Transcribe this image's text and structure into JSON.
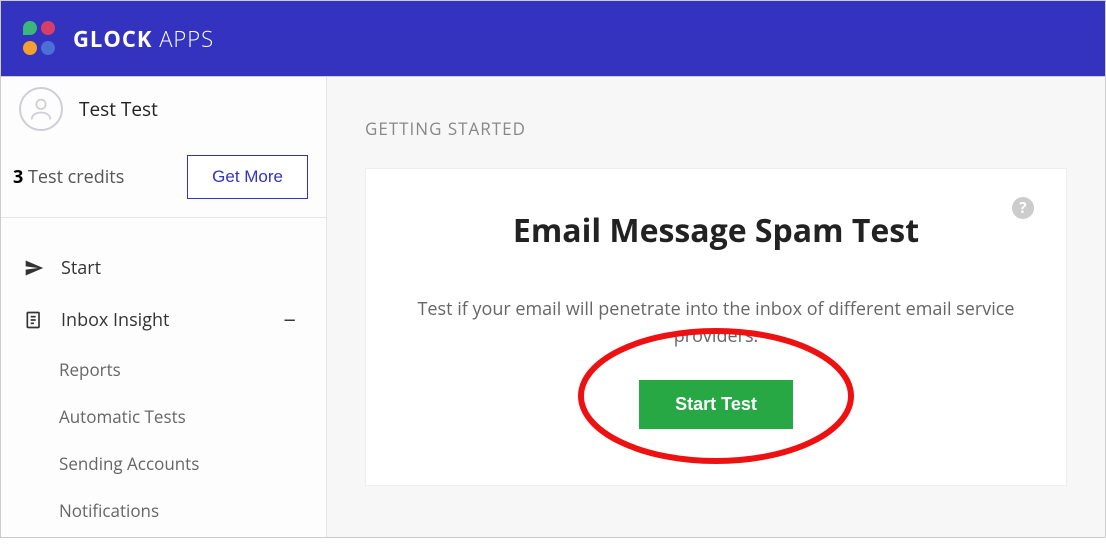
{
  "brand": {
    "name_bold": "GLOCK",
    "name_light": " APPS",
    "colors": [
      "#3ab879",
      "#d73f6a",
      "#f4a02e",
      "#4a6fd6"
    ]
  },
  "user": {
    "name": "Test Test",
    "credits_count": "3",
    "credits_label": " Test credits",
    "get_more_label": "Get More"
  },
  "nav": {
    "start": "Start",
    "inbox_insight": "Inbox Insight",
    "sub": {
      "reports": "Reports",
      "automatic_tests": "Automatic Tests",
      "sending_accounts": "Sending Accounts",
      "notifications": "Notifications"
    }
  },
  "main": {
    "section_title": "GETTING STARTED",
    "card_title": "Email Message Spam Test",
    "card_desc": "Test if your email will penetrate into the inbox of different email service providers.",
    "start_test_label": "Start Test",
    "help": "?"
  }
}
